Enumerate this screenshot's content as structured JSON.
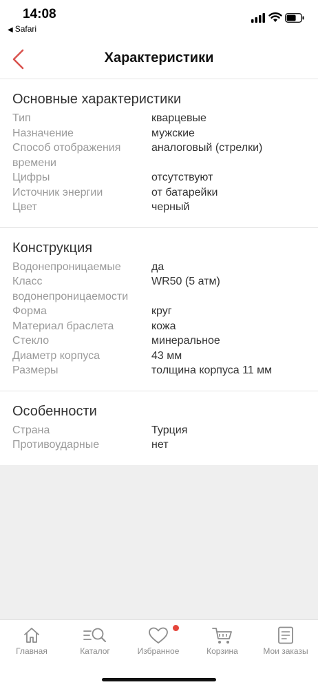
{
  "status": {
    "time": "14:08",
    "back_app": "Safari",
    "icons": [
      "signal-icon",
      "wifi-icon",
      "battery-icon"
    ]
  },
  "header": {
    "title": "Характеристики",
    "back_icon": "chevron-left-icon",
    "accent_color": "#d9534f"
  },
  "sections": [
    {
      "title": "Основные характеристики",
      "rows": [
        {
          "label": "Тип",
          "value": "кварцевые"
        },
        {
          "label": "Назначение",
          "value": "мужские"
        },
        {
          "label": "Способ отображения времени",
          "value": "аналоговый (стрелки)"
        },
        {
          "label": "Цифры",
          "value": "отсутствуют"
        },
        {
          "label": "Источник энергии",
          "value": "от батарейки"
        },
        {
          "label": "Цвет",
          "value": "черный"
        }
      ]
    },
    {
      "title": "Конструкция",
      "rows": [
        {
          "label": "Водонепроницаемые",
          "value": "да"
        },
        {
          "label": "Класс водонепроницаемости",
          "value": "WR50 (5 атм)"
        },
        {
          "label": "Форма",
          "value": "круг"
        },
        {
          "label": "Материал браслета",
          "value": "кожа"
        },
        {
          "label": "Стекло",
          "value": "минеральное"
        },
        {
          "label": "Диаметр корпуса",
          "value": "43 мм"
        },
        {
          "label": "Размеры",
          "value": "толщина корпуса 11 мм"
        }
      ]
    },
    {
      "title": "Особенности",
      "rows": [
        {
          "label": "Страна",
          "value": "Турция"
        },
        {
          "label": "Противоударные",
          "value": "нет"
        }
      ]
    }
  ],
  "tabbar": {
    "items": [
      {
        "label": "Главная",
        "icon": "home-icon"
      },
      {
        "label": "Каталог",
        "icon": "catalog-search-icon"
      },
      {
        "label": "Избранное",
        "icon": "heart-icon",
        "badge": true
      },
      {
        "label": "Корзина",
        "icon": "cart-icon"
      },
      {
        "label": "Мои заказы",
        "icon": "orders-icon"
      }
    ],
    "badge_color": "#e5453b"
  }
}
